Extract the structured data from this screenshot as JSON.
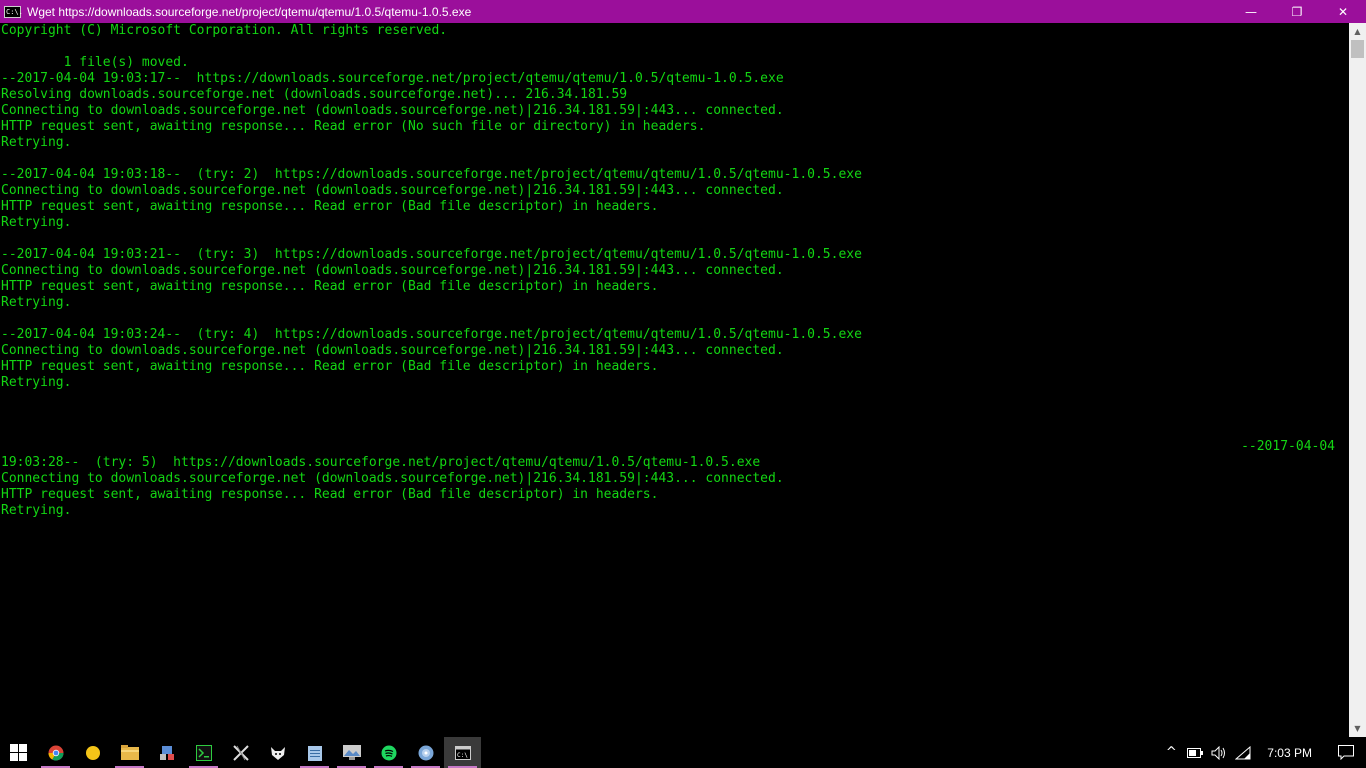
{
  "window": {
    "title": "Wget https://downloads.sourceforge.net/project/qtemu/qtemu/1.0.5/qtemu-1.0.5.exe",
    "app_icon_text": "C:\\.",
    "minimize": "—",
    "maximize": "❐",
    "close": "✕"
  },
  "console": {
    "lines": [
      "Copyright (C) Microsoft Corporation. All rights reserved.",
      "",
      "        1 file(s) moved.",
      "--2017-04-04 19:03:17--  https://downloads.sourceforge.net/project/qtemu/qtemu/1.0.5/qtemu-1.0.5.exe",
      "Resolving downloads.sourceforge.net (downloads.sourceforge.net)... 216.34.181.59",
      "Connecting to downloads.sourceforge.net (downloads.sourceforge.net)|216.34.181.59|:443... connected.",
      "HTTP request sent, awaiting response... Read error (No such file or directory) in headers.",
      "Retrying.",
      "",
      "--2017-04-04 19:03:18--  (try: 2)  https://downloads.sourceforge.net/project/qtemu/qtemu/1.0.5/qtemu-1.0.5.exe",
      "Connecting to downloads.sourceforge.net (downloads.sourceforge.net)|216.34.181.59|:443... connected.",
      "HTTP request sent, awaiting response... Read error (Bad file descriptor) in headers.",
      "Retrying.",
      "",
      "--2017-04-04 19:03:21--  (try: 3)  https://downloads.sourceforge.net/project/qtemu/qtemu/1.0.5/qtemu-1.0.5.exe",
      "Connecting to downloads.sourceforge.net (downloads.sourceforge.net)|216.34.181.59|:443... connected.",
      "HTTP request sent, awaiting response... Read error (Bad file descriptor) in headers.",
      "Retrying.",
      "",
      "--2017-04-04 19:03:24--  (try: 4)  https://downloads.sourceforge.net/project/qtemu/qtemu/1.0.5/qtemu-1.0.5.exe",
      "Connecting to downloads.sourceforge.net (downloads.sourceforge.net)|216.34.181.59|:443... connected.",
      "HTTP request sent, awaiting response... Read error (Bad file descriptor) in headers.",
      "Retrying.",
      "",
      "",
      ""
    ],
    "wrapped_tail": "--2017-04-04",
    "lines_after": [
      "19:03:28--  (try: 5)  https://downloads.sourceforge.net/project/qtemu/qtemu/1.0.5/qtemu-1.0.5.exe",
      "Connecting to downloads.sourceforge.net (downloads.sourceforge.net)|216.34.181.59|:443... connected.",
      "HTTP request sent, awaiting response... Read error (Bad file descriptor) in headers.",
      "Retrying."
    ],
    "text_color": "#13d613"
  },
  "scrollbar": {
    "up": "▲",
    "down": "▼"
  },
  "taskbar": {
    "apps": [
      {
        "name": "chrome-icon",
        "underline": true
      },
      {
        "name": "sticky-notes-icon",
        "underline": false
      },
      {
        "name": "file-explorer-icon",
        "underline": true
      },
      {
        "name": "network-tool-icon",
        "underline": false
      },
      {
        "name": "terminal-app-icon",
        "underline": true
      },
      {
        "name": "x-tool-icon",
        "underline": false
      },
      {
        "name": "fox-icon",
        "underline": false
      },
      {
        "name": "notepad-icon",
        "underline": true
      },
      {
        "name": "photos-icon",
        "underline": true
      },
      {
        "name": "spotify-icon",
        "underline": true
      },
      {
        "name": "disc-icon",
        "underline": true
      },
      {
        "name": "cmd-icon",
        "underline": true,
        "active": true
      }
    ],
    "tray": {
      "chevron": "^",
      "clock": "7:03 PM"
    }
  }
}
